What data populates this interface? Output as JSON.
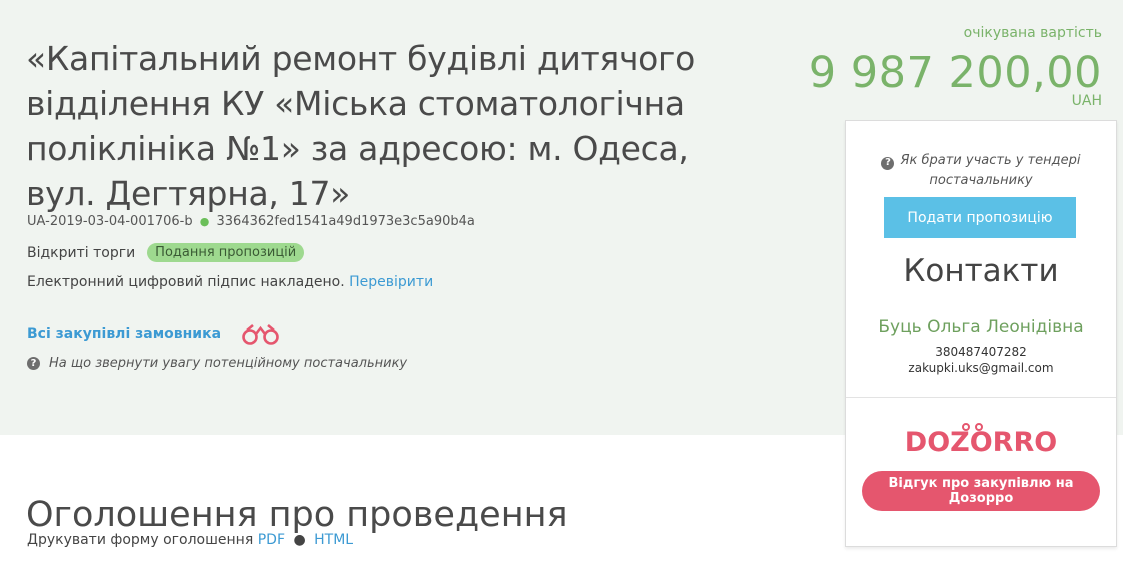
{
  "tender": {
    "title": "«Капітальний ремонт будівлі дитячого відділення КУ «Міська стоматологічна поліклініка №1» за адресою: м. Одеса, вул. Дегтярна, 17»",
    "id": "UA-2019-03-04-001706-b",
    "hash": "3364362fed1541a49d1973e3c5a90b4a",
    "procedure_type": "Відкриті торги",
    "status": "Подання пропозицій",
    "signature_text": "Електронний цифровий підпис накладено.",
    "signature_link": "Перевірити",
    "all_purchases_link": "Всі закупівлі замовника",
    "attention_text": "На що звернути увагу потенційному постачальнику"
  },
  "value": {
    "label": "очікувана вартість",
    "amount": "9 987 200,00",
    "currency": "UAH"
  },
  "panel": {
    "how_to": "Як брати участь у тендері постачальнику",
    "submit_button": "Подати пропозицію",
    "contacts_title": "Контакти",
    "contact_name": "Буць Ольга Леонідівна",
    "contact_phone": "380487407282",
    "contact_email": "zakupki.uks@gmail.com",
    "dozorro_logo": "DOZORRO",
    "dozorro_button": "Відгук про закупівлю на Дозорро"
  },
  "announcement": {
    "title": "Оголошення про проведення",
    "print_label": "Друкувати форму оголошення",
    "pdf_link": "PDF",
    "separator": "●",
    "html_link": "HTML"
  },
  "icons": {
    "help": "question-circle-icon",
    "binoculars": "binoculars-icon",
    "dot": "green-dot-icon"
  },
  "colors": {
    "header_bg": "#f0f4f0",
    "accent_green": "#7ab36a",
    "link_blue": "#3c9ad3",
    "submit_blue": "#5bc0e6",
    "dozorro_red": "#e5566e",
    "status_green": "#9ed98f"
  }
}
